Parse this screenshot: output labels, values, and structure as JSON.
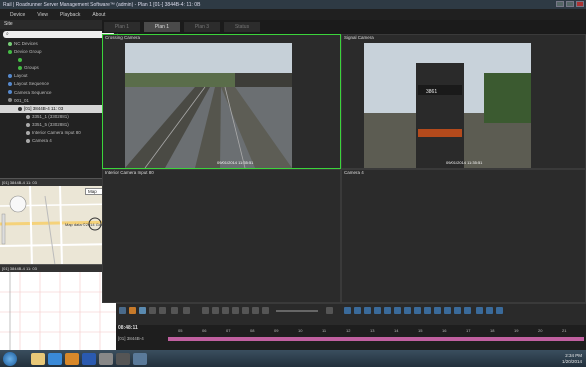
{
  "window": {
    "title": "Rail | Roadrunner Server Management Software™ (admin) - Plan 1  [01-] 3844B-4: 11: 0B"
  },
  "menu": [
    "Device",
    "View",
    "Playback",
    "About"
  ],
  "sidebar": {
    "header": "Site",
    "items": [
      {
        "label": "NC Devices"
      },
      {
        "label": "Device Group"
      },
      {
        "label": ""
      },
      {
        "label": "Groups"
      },
      {
        "label": "Layout"
      },
      {
        "label": "Layout Sequence"
      },
      {
        "label": "Camera Sequence"
      },
      {
        "label": "001_01"
      },
      {
        "label": "[01] 3844B-4 11: 03",
        "selected": true
      },
      {
        "label": "3351_1 (3302881)"
      },
      {
        "label": "3351_5 (3302881)"
      },
      {
        "label": "Interior Camera Input 80"
      },
      {
        "label": "Camera 4"
      }
    ]
  },
  "map": {
    "header": "[01] 3844B-4 11: 03",
    "select": "Map",
    "caption": "Map data ©2014 Google"
  },
  "graph": {
    "header": "[01] 3844B-4 11: 03"
  },
  "tabs": [
    {
      "label": "Plan 1",
      "active": false
    },
    {
      "label": "Plan 1",
      "active": true
    },
    {
      "label": "Plan 3",
      "active": false
    },
    {
      "label": "Status",
      "active": false
    }
  ],
  "panes": [
    {
      "label": "Crossing Camera",
      "stamp": "09/01/2014  11:35:51"
    },
    {
      "label": "Signal Camera",
      "stamp": "09/01/2014  11:35:51"
    },
    {
      "label": "Interior Camera Input 80"
    },
    {
      "label": "Camera 4"
    }
  ],
  "timeline": {
    "time": "08:48:11",
    "track": "[01] 3844B-4",
    "ticks": [
      "05",
      "06",
      "07",
      "08",
      "09",
      "10",
      "11",
      "12",
      "13",
      "14",
      "15",
      "16",
      "17",
      "18",
      "19",
      "20",
      "21"
    ]
  },
  "taskbar": {
    "time": "2:34 PM",
    "date": "1/20/2014"
  },
  "colors": {
    "active_pane": "#3bd43b",
    "track": "#c060a0"
  }
}
